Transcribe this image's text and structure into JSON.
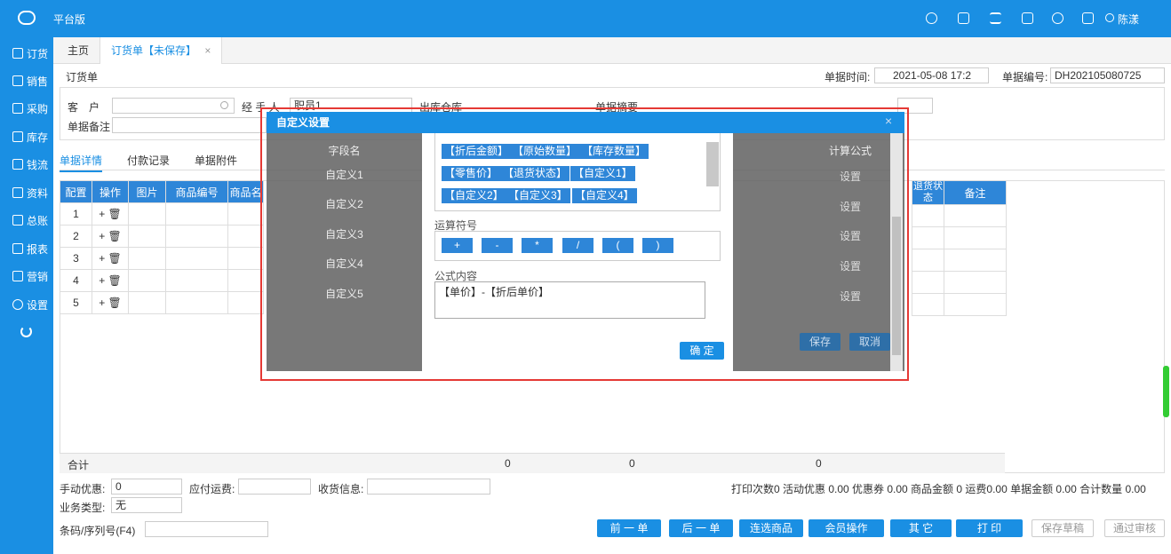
{
  "app": {
    "title": "平台版",
    "user": "陈漾"
  },
  "sidebar": {
    "items": [
      "订货",
      "销售",
      "采购",
      "库存",
      "钱流",
      "资料",
      "总账",
      "报表",
      "营销",
      "设置"
    ]
  },
  "tabs": {
    "home": "主页",
    "active": "订货单【未保存】",
    "close": "×"
  },
  "form": {
    "title": "订货单",
    "time_label": "单据时间:",
    "time_value": "2021-05-08 17:2",
    "no_label": "单据编号:",
    "no_value": "DH202105080725",
    "customer_label": "客　户",
    "handler_label": "经 手 人",
    "handler_value": "职员1",
    "warehouse_label": "出库仓库",
    "summary_label": "单据摘要",
    "remark_label": "单据备注"
  },
  "subtabs": [
    "单据详情",
    "付款记录",
    "单据附件"
  ],
  "table": {
    "headers": [
      "配置",
      "操作",
      "图片",
      "商品编号",
      "商品名"
    ],
    "right_headers": [
      "退货状态",
      "备注"
    ],
    "rows": [
      "1",
      "2",
      "3",
      "4",
      "5"
    ],
    "total_label": "合计",
    "totals": [
      "0",
      "0",
      "0"
    ]
  },
  "footer": {
    "discount_label": "手动优惠:",
    "discount_value": "0",
    "freight_label": "应付运费:",
    "receive_label": "收货信息:",
    "biztype_label": "业务类型:",
    "biztype_value": "无",
    "barcode_label": "条码/序列号(F4)",
    "summary": "打印次数0  活动优惠 0.00  优惠券 0.00  商品金额 0  运费0.00  单据金额 0.00  合计数量 0.00"
  },
  "buttons": {
    "prev": "前 一 单",
    "next": "后 一 单",
    "select": "连选商品",
    "member": "会员操作",
    "other": "其 它",
    "print": "打 印",
    "draft": "保存草稿",
    "approve": "通过审核"
  },
  "dialog": {
    "title": "自定义设置",
    "close": "×",
    "field_header": "字段名",
    "fields": [
      "自定义1",
      "自定义2",
      "自定义3",
      "自定义4",
      "自定义5"
    ],
    "formula_header": "计算公式",
    "set_label": "设置",
    "tags_row1": [
      "【折后金额】",
      "【原始数量】",
      "【库存数量】"
    ],
    "tags_row2": [
      "【零售价】",
      "【退货状态】",
      "【自定义1】"
    ],
    "tags_row3": [
      "【自定义2】",
      "【自定义3】",
      "【自定义4】"
    ],
    "operators_label": "运算符号",
    "operators": [
      "+",
      "-",
      "*",
      "/",
      "(",
      ")"
    ],
    "formula_label": "公式内容",
    "formula_value": "【单价】-【折后单价】",
    "confirm": "确 定",
    "save": "保存",
    "cancel": "取消"
  }
}
